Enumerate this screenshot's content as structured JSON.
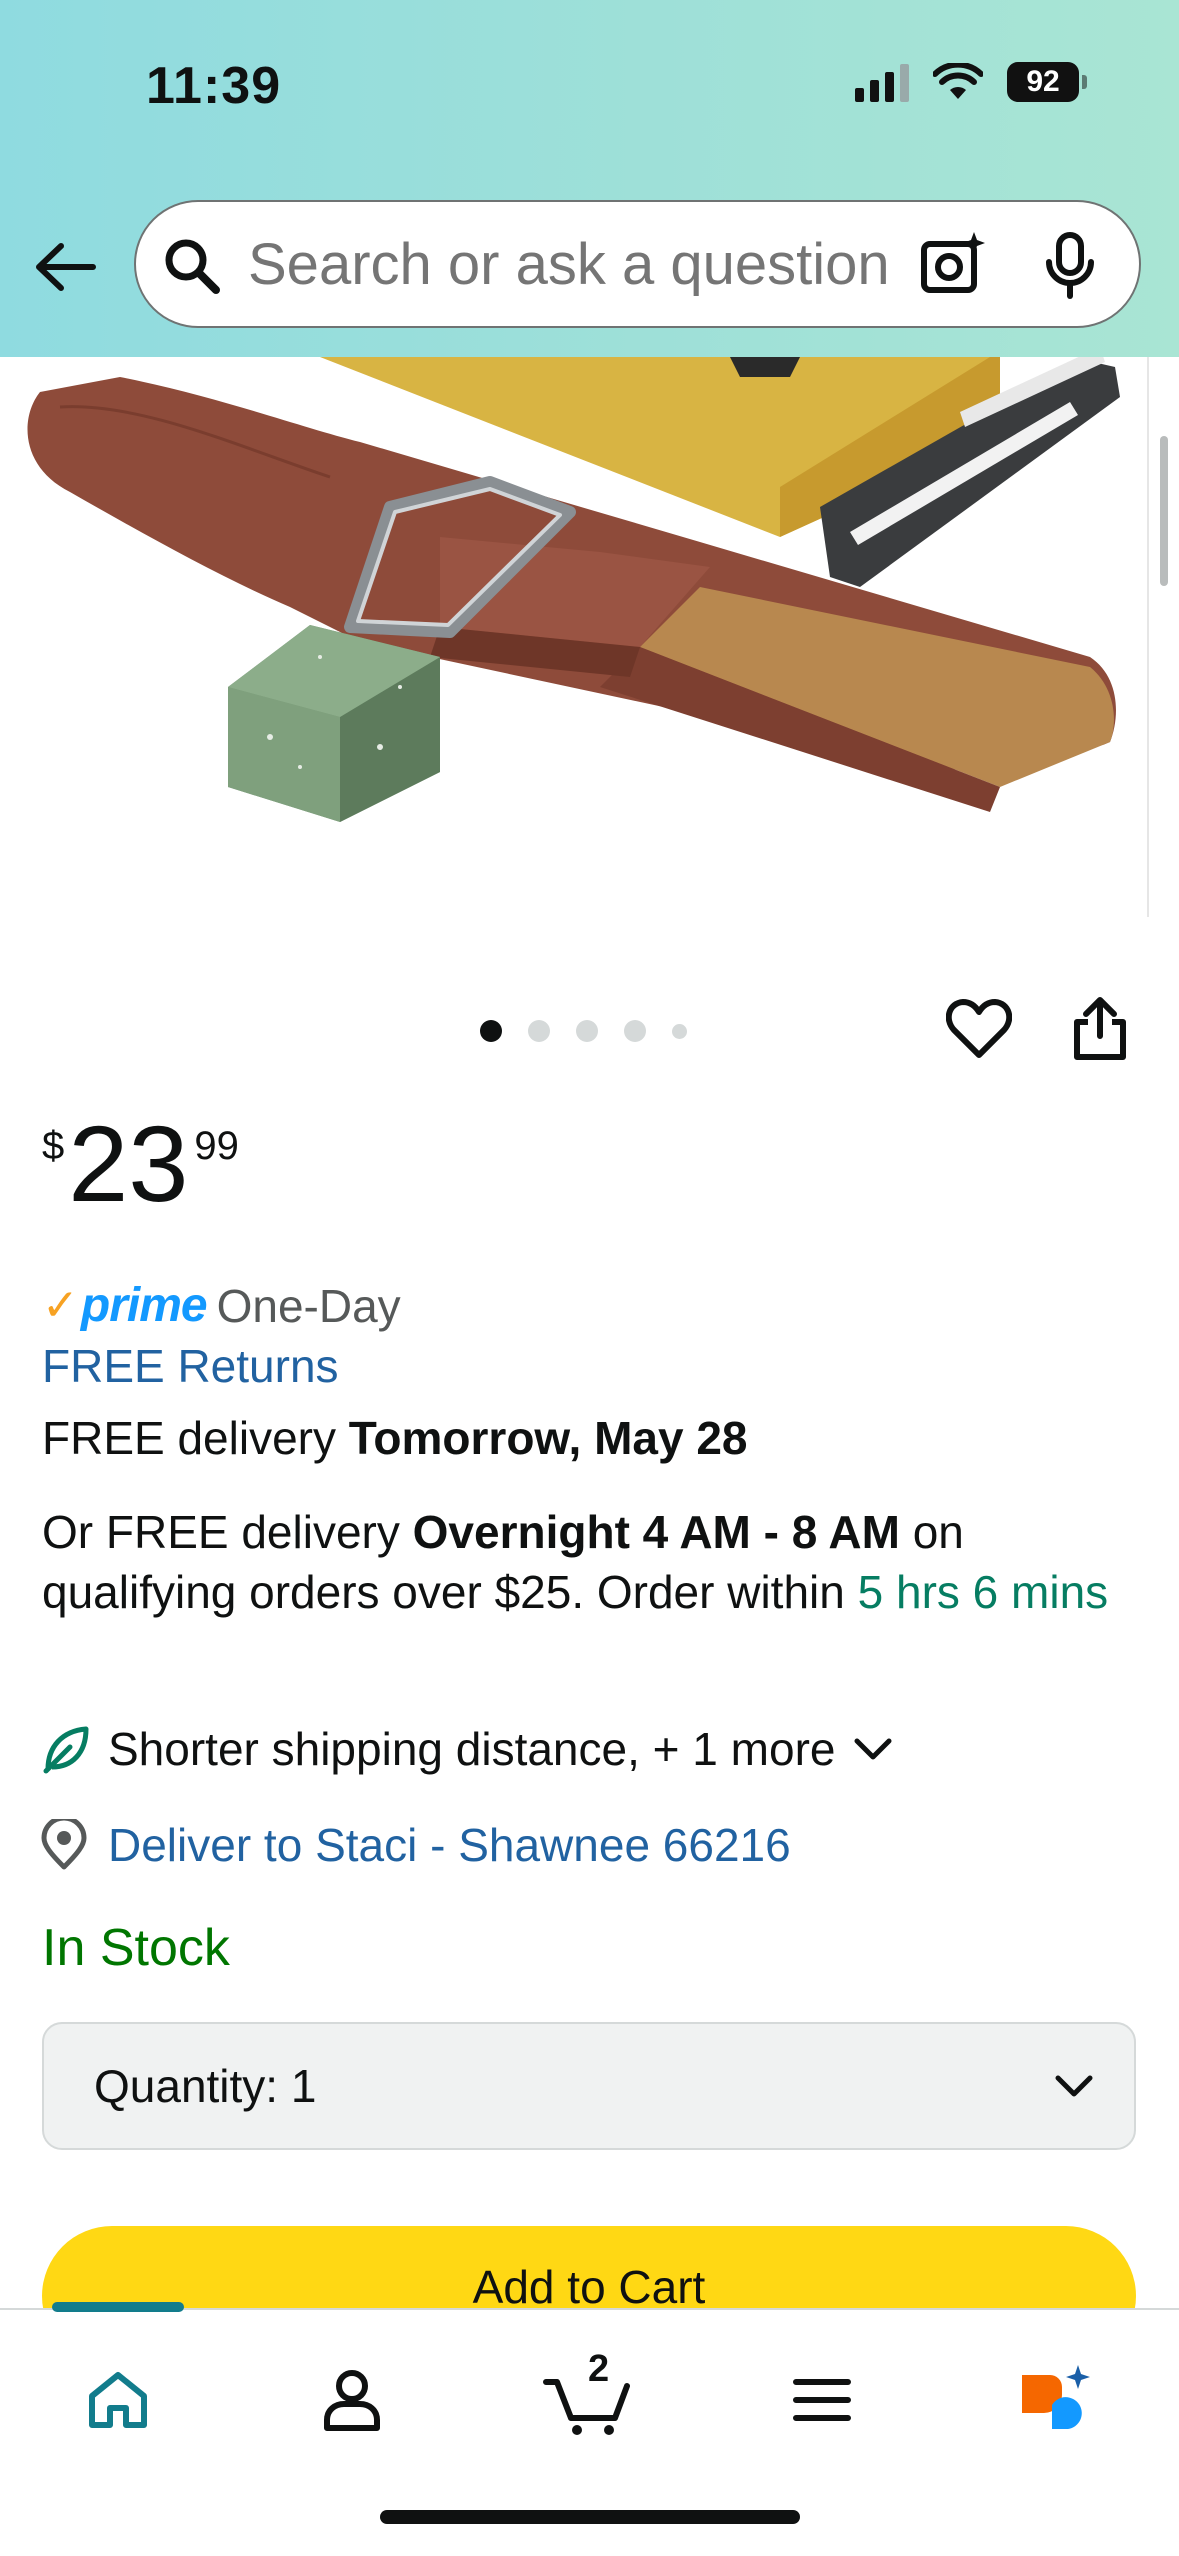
{
  "status_bar": {
    "time": "11:39",
    "battery": "92"
  },
  "search": {
    "placeholder": "Search or ask a question"
  },
  "icons": {
    "back": "arrow-left-icon",
    "search": "search-icon",
    "lens": "camera-lens-icon",
    "mic": "microphone-icon",
    "wishlist": "heart-icon",
    "share": "share-icon",
    "leaf": "leaf-icon",
    "location": "location-pin-icon",
    "chevron": "chevron-down-icon",
    "home": "home-icon",
    "account": "person-icon",
    "cart": "cart-icon",
    "menu": "hamburger-menu-icon",
    "rufus": "rufus-ai-icon"
  },
  "product": {
    "image_alt": "Leather strop with compound bar and sharpener",
    "carousel": {
      "dot_count": 5,
      "active_index": 0
    },
    "price": {
      "symbol": "$",
      "whole": "23",
      "fraction": "99"
    }
  },
  "delivery": {
    "prime_check": "✓",
    "prime_label": "prime",
    "prime_speed": "One-Day",
    "free_returns": "FREE Returns",
    "free_delivery_prefix": "FREE delivery ",
    "free_delivery_date": "Tomorrow, May 28",
    "overnight_prefix": "Or FREE delivery ",
    "overnight_window": "Overnight 4 AM - 8 AM",
    "overnight_suffix": " on qualifying orders over $25. Order within ",
    "countdown": "5 hrs 6 mins",
    "shipping_note": "Shorter shipping distance, + 1 more",
    "deliver_to": "Deliver to Staci - Shawnee 66216"
  },
  "availability": "In Stock",
  "quantity": {
    "label": "Quantity:",
    "value": "1"
  },
  "add_to_cart": "Add to Cart",
  "bottom_nav": {
    "cart_count": "2"
  },
  "colors": {
    "header_gradient_start": "#8fdbe0",
    "header_gradient_end": "#a9e5d4",
    "link": "#2162a1",
    "in_stock": "#007600",
    "countdown": "#067d62",
    "prime_blue": "#1399ff",
    "prime_check": "#f7a223",
    "add_to_cart": "#ffd814",
    "nav_active": "#127c8c",
    "rufus_orange": "#f56700",
    "rufus_blue": "#1399ff"
  }
}
